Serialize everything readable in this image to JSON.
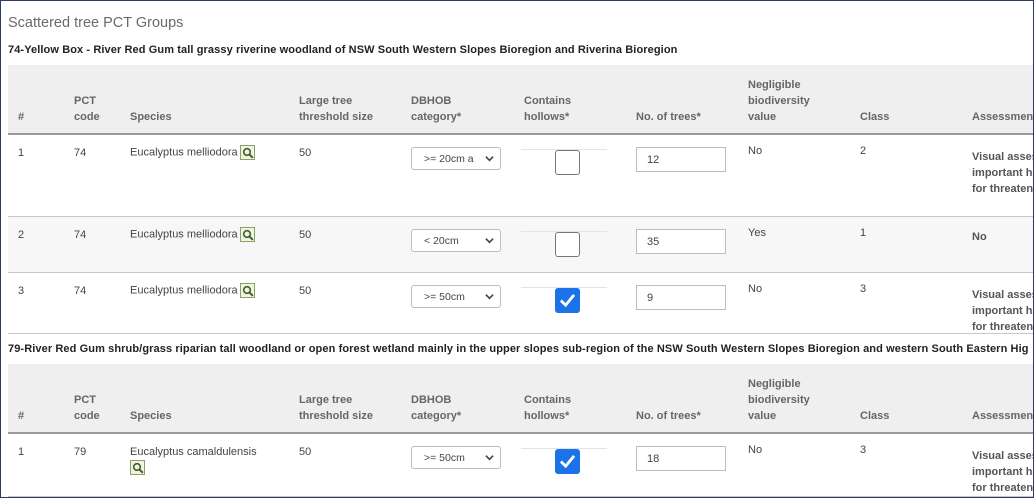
{
  "page": {
    "title": "Scattered tree PCT Groups"
  },
  "columns": {
    "num": "#",
    "pct_code": [
      "PCT",
      "code"
    ],
    "species": "Species",
    "threshold": [
      "Large tree",
      "threshold size"
    ],
    "dbhob": [
      "DBHOB",
      "category*"
    ],
    "hollows": [
      "Contains",
      "hollows*"
    ],
    "trees": "No. of trees*",
    "negligible": [
      "Negligible",
      "biodiversity",
      "value"
    ],
    "class": "Class",
    "assessment": "Assessmen"
  },
  "groups": [
    {
      "title": "74-Yellow Box - River Red Gum tall grassy riverine woodland of NSW South Western Slopes Bioregion and Riverina Bioregion",
      "rows": [
        {
          "num": "1",
          "pct": "74",
          "species": "Eucalyptus melliodora",
          "threshold": "50",
          "dbhob": ">= 20cm a",
          "hollows": false,
          "trees": "12",
          "negligible": "No",
          "class": "2",
          "assessment": [
            "Visual asses",
            "important ha",
            "for threaten"
          ]
        },
        {
          "num": "2",
          "pct": "74",
          "species": "Eucalyptus melliodora",
          "threshold": "50",
          "dbhob": "< 20cm",
          "hollows": false,
          "trees": "35",
          "negligible": "Yes",
          "class": "1",
          "assessment": [
            "No"
          ]
        },
        {
          "num": "3",
          "pct": "74",
          "species": "Eucalyptus melliodora",
          "threshold": "50",
          "dbhob": ">= 50cm",
          "hollows": true,
          "trees": "9",
          "negligible": "No",
          "class": "3",
          "assessment": [
            "Visual asses",
            "important ha",
            "for threaten"
          ]
        }
      ]
    },
    {
      "title": "79-River Red Gum shrub/grass riparian tall woodland or open forest wetland mainly in the upper slopes sub-region of the NSW South Western Slopes Bioregion and western South Eastern Hig",
      "rows": [
        {
          "num": "1",
          "pct": "79",
          "species": "Eucalyptus camaldulensis",
          "threshold": "50",
          "dbhob": ">= 50cm",
          "hollows": true,
          "trees": "18",
          "negligible": "No",
          "class": "3",
          "assessment": [
            "Visual asses",
            "important ha",
            "for threaten"
          ]
        }
      ]
    }
  ],
  "icons": {
    "species_lookup": "magnifier-icon",
    "dropdown": "chevron-down-icon",
    "checkmark": "check-icon"
  },
  "colors": {
    "checkbox_checked": "#1a73e8",
    "lookup_icon_border": "#8fa067"
  }
}
